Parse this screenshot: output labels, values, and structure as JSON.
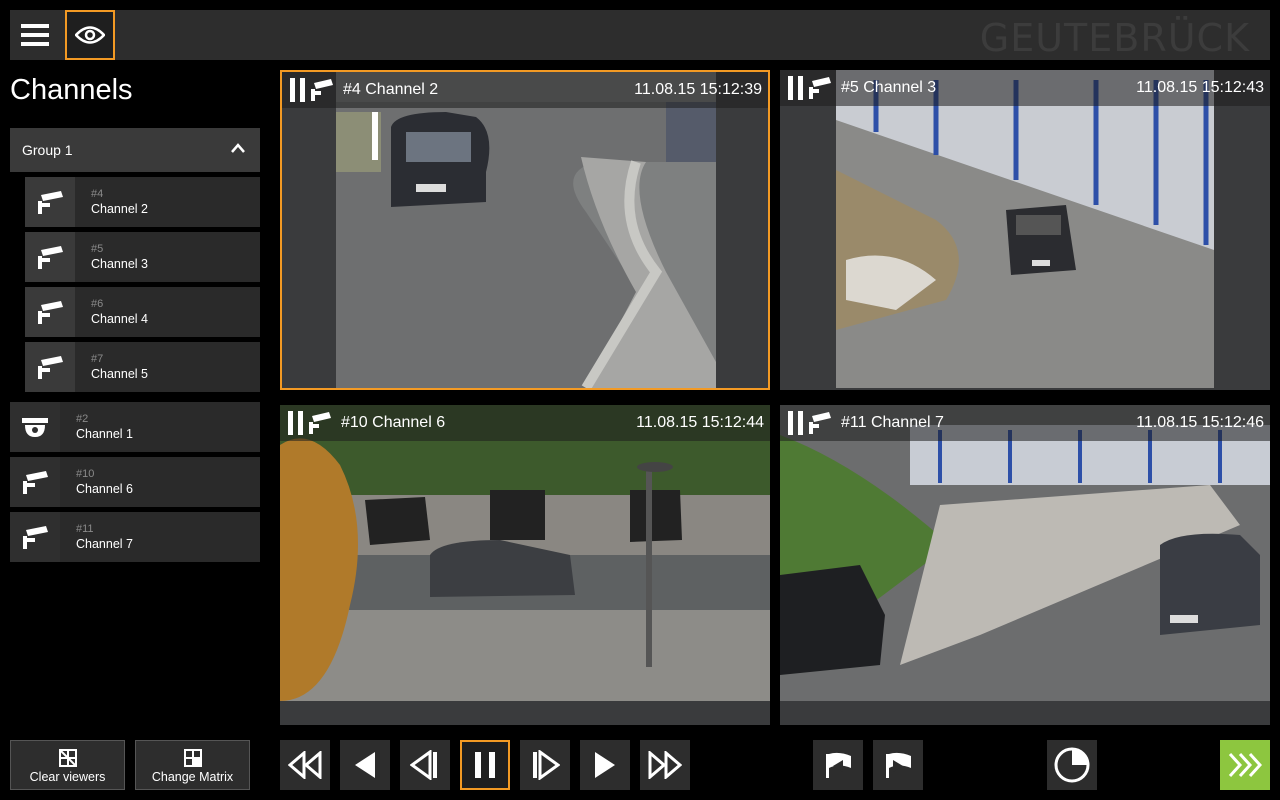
{
  "header": {
    "brand": "GEUTEBRÜCK"
  },
  "sidebar": {
    "title": "Channels",
    "group": {
      "label": "Group 1"
    },
    "group_items": [
      {
        "num": "#4",
        "name": "Channel 2"
      },
      {
        "num": "#5",
        "name": "Channel 3"
      },
      {
        "num": "#6",
        "name": "Channel 4"
      },
      {
        "num": "#7",
        "name": "Channel 5"
      }
    ],
    "items": [
      {
        "num": "#2",
        "name": "Channel 1"
      },
      {
        "num": "#10",
        "name": "Channel 6"
      },
      {
        "num": "#11",
        "name": "Channel 7"
      }
    ]
  },
  "viewers": [
    {
      "title": "#4 Channel 2",
      "timestamp": "11.08.15 15:12:39",
      "selected": true
    },
    {
      "title": "#5 Channel 3",
      "timestamp": "11.08.15 15:12:43"
    },
    {
      "title": "#10 Channel 6",
      "timestamp": "11.08.15 15:12:44"
    },
    {
      "title": "#11 Channel 7",
      "timestamp": "11.08.15 15:12:46"
    }
  ],
  "footer": {
    "clear_label": "Clear viewers",
    "matrix_label": "Change Matrix"
  },
  "colors": {
    "accent": "#f39a24",
    "go": "#8dc63f",
    "panel": "#2d2d2d"
  }
}
